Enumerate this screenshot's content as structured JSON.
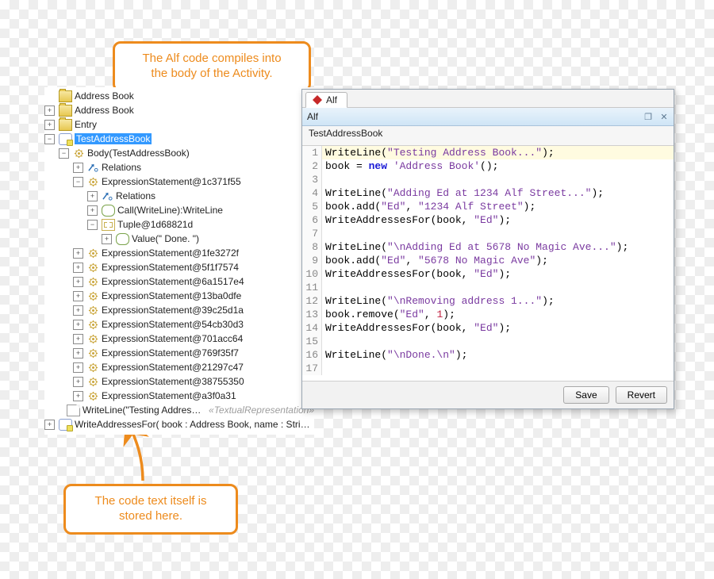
{
  "callouts": {
    "top": "The Alf code compiles into the body of the Activity.",
    "bottom": "The code text itself is stored here."
  },
  "tree": {
    "rows": [
      {
        "depth": 0,
        "tw": "blank",
        "icon": "pkg",
        "label": "Address Book"
      },
      {
        "depth": 0,
        "tw": "plus",
        "icon": "pkg",
        "label": "Address Book"
      },
      {
        "depth": 0,
        "tw": "plus",
        "icon": "pkg",
        "label": "Entry"
      },
      {
        "depth": 0,
        "tw": "minus",
        "icon": "act",
        "label": "TestAddressBook",
        "selected": true
      },
      {
        "depth": 1,
        "tw": "minus",
        "icon": "gear",
        "label": "Body(TestAddressBook)"
      },
      {
        "depth": 2,
        "tw": "plus",
        "icon": "arrow",
        "label": "Relations"
      },
      {
        "depth": 2,
        "tw": "minus",
        "icon": "gear",
        "label": "ExpressionStatement@1c371f55"
      },
      {
        "depth": 3,
        "tw": "plus",
        "icon": "arrow",
        "label": "Relations"
      },
      {
        "depth": 3,
        "tw": "plus",
        "icon": "pill",
        "label": "Call(WriteLine):WriteLine"
      },
      {
        "depth": 3,
        "tw": "minus",
        "icon": "tuple",
        "label": "Tuple@1d68821d"
      },
      {
        "depth": 4,
        "tw": "plus",
        "icon": "pill",
        "label": "Value(\" Done. \")"
      },
      {
        "depth": 2,
        "tw": "plus",
        "icon": "gear",
        "label": "ExpressionStatement@1fe3272f"
      },
      {
        "depth": 2,
        "tw": "plus",
        "icon": "gear",
        "label": "ExpressionStatement@5f1f7574"
      },
      {
        "depth": 2,
        "tw": "plus",
        "icon": "gear",
        "label": "ExpressionStatement@6a1517e4"
      },
      {
        "depth": 2,
        "tw": "plus",
        "icon": "gear",
        "label": "ExpressionStatement@13ba0dfe"
      },
      {
        "depth": 2,
        "tw": "plus",
        "icon": "gear",
        "label": "ExpressionStatement@39c25d1a"
      },
      {
        "depth": 2,
        "tw": "plus",
        "icon": "gear",
        "label": "ExpressionStatement@54cb30d3"
      },
      {
        "depth": 2,
        "tw": "plus",
        "icon": "gear",
        "label": "ExpressionStatement@701acc64"
      },
      {
        "depth": 2,
        "tw": "plus",
        "icon": "gear",
        "label": "ExpressionStatement@769f35f7"
      },
      {
        "depth": 2,
        "tw": "plus",
        "icon": "gear",
        "label": "ExpressionStatement@21297c47"
      },
      {
        "depth": 2,
        "tw": "plus",
        "icon": "gear",
        "label": "ExpressionStatement@38755350"
      },
      {
        "depth": 2,
        "tw": "plus",
        "icon": "gear",
        "label": "ExpressionStatement@a3f0a31"
      },
      {
        "depth": 1,
        "tw": "blank",
        "icon": "note",
        "label": "WriteLine(\"Testing Address Book...\"); book = new '…",
        "suffix": "«TextualRepresentation»"
      },
      {
        "depth": 0,
        "tw": "plus",
        "icon": "func",
        "label": "WriteAddressesFor( book : Address Book, name : String )"
      }
    ]
  },
  "editor": {
    "tab_label": "Alf",
    "title": "Alf",
    "crumb": "TestAddressBook",
    "buttons": {
      "save": "Save",
      "revert": "Revert"
    },
    "code": [
      {
        "n": 1,
        "hl": true,
        "seg": [
          [
            "call",
            "WriteLine("
          ],
          [
            "str",
            "\"Testing Address Book...\""
          ],
          [
            "id",
            ");"
          ]
        ]
      },
      {
        "n": 2,
        "seg": [
          [
            "id",
            "book = "
          ],
          [
            "kw",
            "new"
          ],
          [
            "id",
            " "
          ],
          [
            "str",
            "'Address Book'"
          ],
          [
            "id",
            "();"
          ]
        ]
      },
      {
        "n": 3,
        "seg": []
      },
      {
        "n": 4,
        "seg": [
          [
            "call",
            "WriteLine("
          ],
          [
            "str",
            "\"Adding Ed at 1234 Alf Street...\""
          ],
          [
            "id",
            ");"
          ]
        ]
      },
      {
        "n": 5,
        "seg": [
          [
            "id",
            "book.add("
          ],
          [
            "str",
            "\"Ed\""
          ],
          [
            "id",
            ", "
          ],
          [
            "str",
            "\"1234 Alf Street\""
          ],
          [
            "id",
            ");"
          ]
        ]
      },
      {
        "n": 6,
        "seg": [
          [
            "id",
            "WriteAddressesFor(book, "
          ],
          [
            "str",
            "\"Ed\""
          ],
          [
            "id",
            ");"
          ]
        ]
      },
      {
        "n": 7,
        "seg": []
      },
      {
        "n": 8,
        "seg": [
          [
            "call",
            "WriteLine("
          ],
          [
            "str",
            "\"\\nAdding Ed at 5678 No Magic Ave...\""
          ],
          [
            "id",
            ");"
          ]
        ]
      },
      {
        "n": 9,
        "seg": [
          [
            "id",
            "book.add("
          ],
          [
            "str",
            "\"Ed\""
          ],
          [
            "id",
            ", "
          ],
          [
            "str",
            "\"5678 No Magic Ave\""
          ],
          [
            "id",
            ");"
          ]
        ]
      },
      {
        "n": 10,
        "seg": [
          [
            "id",
            "WriteAddressesFor(book, "
          ],
          [
            "str",
            "\"Ed\""
          ],
          [
            "id",
            ");"
          ]
        ]
      },
      {
        "n": 11,
        "seg": []
      },
      {
        "n": 12,
        "seg": [
          [
            "call",
            "WriteLine("
          ],
          [
            "str",
            "\"\\nRemoving address 1...\""
          ],
          [
            "id",
            ");"
          ]
        ]
      },
      {
        "n": 13,
        "seg": [
          [
            "id",
            "book.remove("
          ],
          [
            "str",
            "\"Ed\""
          ],
          [
            "id",
            ", "
          ],
          [
            "num",
            "1"
          ],
          [
            "id",
            ");"
          ]
        ]
      },
      {
        "n": 14,
        "seg": [
          [
            "id",
            "WriteAddressesFor(book, "
          ],
          [
            "str",
            "\"Ed\""
          ],
          [
            "id",
            ");"
          ]
        ]
      },
      {
        "n": 15,
        "seg": []
      },
      {
        "n": 16,
        "seg": [
          [
            "call",
            "WriteLine("
          ],
          [
            "str",
            "\"\\nDone.\\n\""
          ],
          [
            "id",
            ");"
          ]
        ]
      },
      {
        "n": 17,
        "seg": []
      }
    ]
  }
}
